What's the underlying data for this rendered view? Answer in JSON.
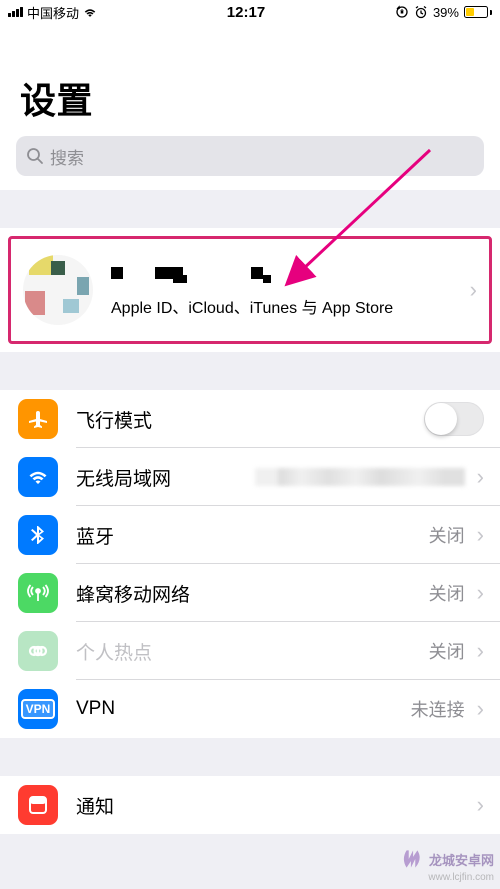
{
  "status": {
    "carrier": "中国移动",
    "time": "12:17",
    "battery_pct": "39%"
  },
  "header": {
    "title": "设置"
  },
  "search": {
    "placeholder": "搜索"
  },
  "profile": {
    "subtitle": "Apple ID、iCloud、iTunes 与 App Store"
  },
  "rows": {
    "airplane": {
      "label": "飞行模式"
    },
    "wifi": {
      "label": "无线局域网"
    },
    "bluetooth": {
      "label": "蓝牙",
      "value": "关闭"
    },
    "cellular": {
      "label": "蜂窝移动网络",
      "value": "关闭"
    },
    "hotspot": {
      "label": "个人热点",
      "value": "关闭"
    },
    "vpn": {
      "label": "VPN",
      "value": "未连接",
      "badge": "VPN"
    },
    "notifications": {
      "label": "通知"
    }
  },
  "watermark": {
    "text": "龙城安卓网",
    "url": "www.lcjfin.com"
  }
}
